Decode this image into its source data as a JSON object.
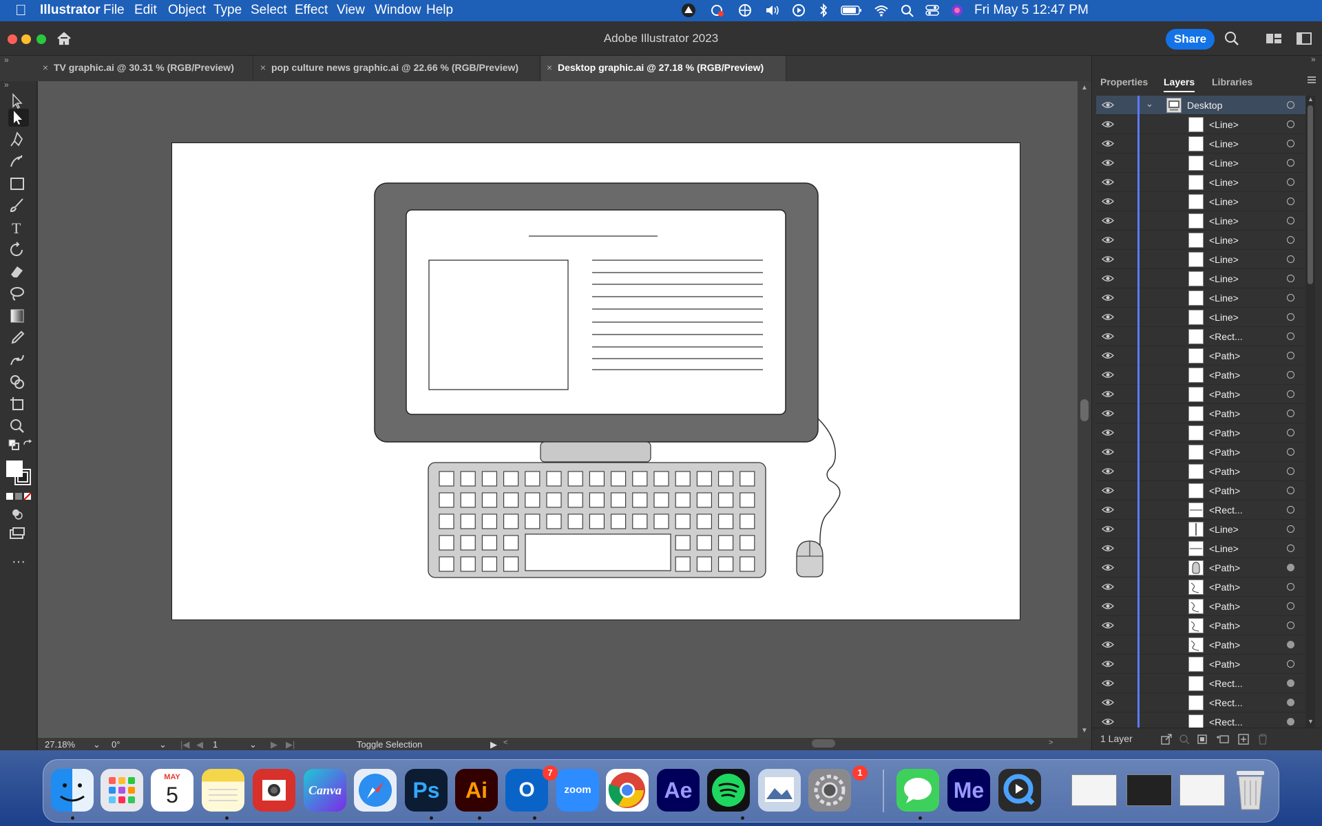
{
  "menubar": {
    "app": "Illustrator",
    "items": [
      "File",
      "Edit",
      "Object",
      "Type",
      "Select",
      "Effect",
      "View",
      "Window",
      "Help"
    ],
    "datetime": "Fri May 5  12:47 PM"
  },
  "window": {
    "title": "Adobe Illustrator 2023",
    "share_label": "Share"
  },
  "tabs": [
    {
      "label": "TV graphic.ai @ 30.31 % (RGB/Preview)",
      "active": false
    },
    {
      "label": "pop culture news graphic.ai @ 22.66 % (RGB/Preview)",
      "active": false
    },
    {
      "label": "Desktop graphic.ai @ 27.18 % (RGB/Preview)",
      "active": true
    }
  ],
  "status": {
    "zoom": "27.18%",
    "rotation": "0°",
    "artboard": "1",
    "tool_label": "Toggle Selection"
  },
  "panel": {
    "tabs": [
      "Properties",
      "Layers",
      "Libraries"
    ],
    "active_tab": "Layers",
    "parent_layer": "Desktop",
    "items": [
      {
        "name": "<Line>",
        "thumb": "blank",
        "target": "empty"
      },
      {
        "name": "<Line>",
        "thumb": "blank",
        "target": "empty"
      },
      {
        "name": "<Line>",
        "thumb": "blank",
        "target": "empty"
      },
      {
        "name": "<Line>",
        "thumb": "blank",
        "target": "empty"
      },
      {
        "name": "<Line>",
        "thumb": "blank",
        "target": "empty"
      },
      {
        "name": "<Line>",
        "thumb": "blank",
        "target": "empty"
      },
      {
        "name": "<Line>",
        "thumb": "blank",
        "target": "empty"
      },
      {
        "name": "<Line>",
        "thumb": "blank",
        "target": "empty"
      },
      {
        "name": "<Line>",
        "thumb": "blank",
        "target": "empty"
      },
      {
        "name": "<Line>",
        "thumb": "blank",
        "target": "empty"
      },
      {
        "name": "<Line>",
        "thumb": "blank",
        "target": "empty"
      },
      {
        "name": "<Rect...",
        "thumb": "blank",
        "target": "empty"
      },
      {
        "name": "<Path>",
        "thumb": "blank",
        "target": "empty"
      },
      {
        "name": "<Path>",
        "thumb": "blank",
        "target": "empty"
      },
      {
        "name": "<Path>",
        "thumb": "blank",
        "target": "empty"
      },
      {
        "name": "<Path>",
        "thumb": "blank",
        "target": "empty"
      },
      {
        "name": "<Path>",
        "thumb": "blank",
        "target": "empty"
      },
      {
        "name": "<Path>",
        "thumb": "blank",
        "target": "empty"
      },
      {
        "name": "<Path>",
        "thumb": "blank",
        "target": "empty"
      },
      {
        "name": "<Path>",
        "thumb": "blank",
        "target": "empty"
      },
      {
        "name": "<Rect...",
        "thumb": "hline",
        "target": "empty"
      },
      {
        "name": "<Line>",
        "thumb": "vline",
        "target": "empty"
      },
      {
        "name": "<Line>",
        "thumb": "hline",
        "target": "empty"
      },
      {
        "name": "<Path>",
        "thumb": "mouse",
        "target": "filled"
      },
      {
        "name": "<Path>",
        "thumb": "curve",
        "target": "empty"
      },
      {
        "name": "<Path>",
        "thumb": "curve",
        "target": "empty"
      },
      {
        "name": "<Path>",
        "thumb": "curve",
        "target": "empty"
      },
      {
        "name": "<Path>",
        "thumb": "curve",
        "target": "filled"
      },
      {
        "name": "<Path>",
        "thumb": "blank",
        "target": "empty"
      },
      {
        "name": "<Rect...",
        "thumb": "blank",
        "target": "filled"
      },
      {
        "name": "<Rect...",
        "thumb": "blank",
        "target": "filled"
      },
      {
        "name": "<Rect...",
        "thumb": "blank",
        "target": "filled"
      }
    ],
    "footer": "1 Layer"
  },
  "dock": {
    "calendar_month": "MAY",
    "calendar_day": "5",
    "outlook_badge": "7",
    "settings_badge": "1",
    "apps": [
      {
        "name": "finder",
        "label": ""
      },
      {
        "name": "launchpad",
        "label": ""
      },
      {
        "name": "calendar",
        "label": ""
      },
      {
        "name": "notes",
        "label": ""
      },
      {
        "name": "photo-booth",
        "label": ""
      },
      {
        "name": "canva",
        "label": "Canva"
      },
      {
        "name": "safari",
        "label": ""
      },
      {
        "name": "photoshop",
        "label": "Ps"
      },
      {
        "name": "illustrator",
        "label": "Ai"
      },
      {
        "name": "outlook",
        "label": "O"
      },
      {
        "name": "zoom",
        "label": "zoom"
      },
      {
        "name": "chrome",
        "label": ""
      },
      {
        "name": "after-effects",
        "label": "Ae"
      },
      {
        "name": "spotify",
        "label": ""
      },
      {
        "name": "preview",
        "label": ""
      },
      {
        "name": "system-settings",
        "label": ""
      },
      {
        "name": "messages",
        "label": ""
      },
      {
        "name": "media-encoder",
        "label": "Me"
      },
      {
        "name": "quicktime",
        "label": ""
      }
    ]
  },
  "colors": {
    "accent": "#1473e6",
    "menubar": "#1e5fb8",
    "layer_color": "#5b7cfc",
    "canvas": "#595959"
  }
}
